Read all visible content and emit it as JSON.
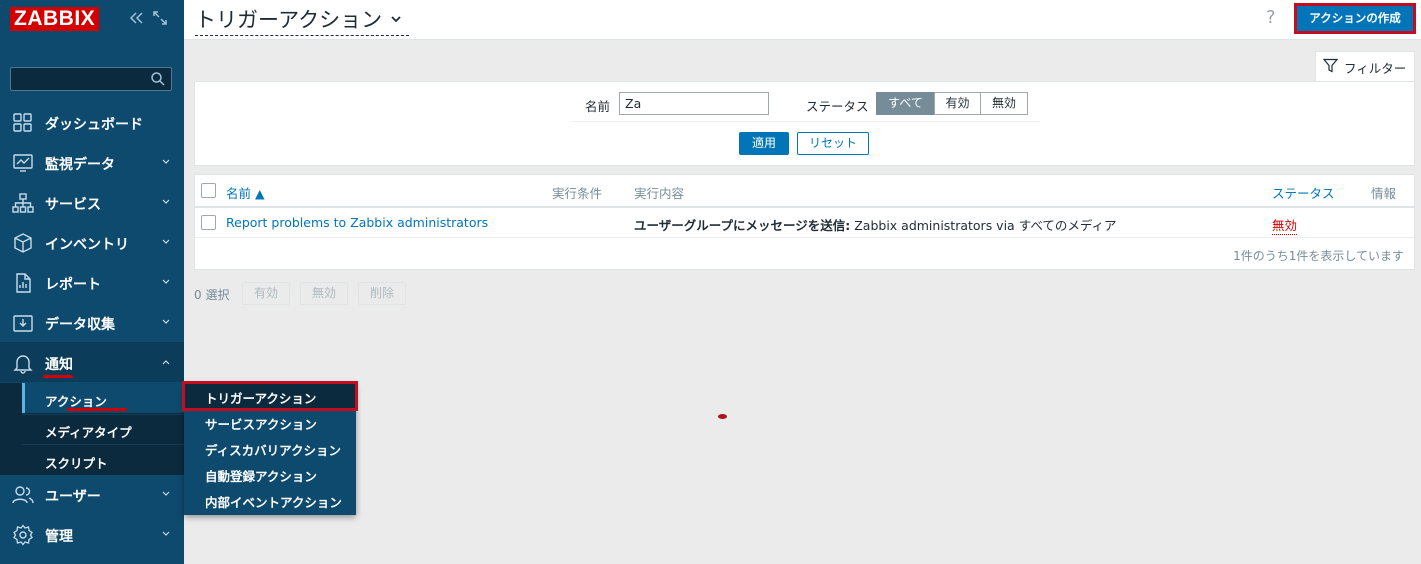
{
  "sidebar": {
    "logo": "ZABBIX",
    "search": {
      "placeholder": "",
      "value": ""
    },
    "items": [
      {
        "label": "ダッシュボード",
        "icon": "dashboard-icon"
      },
      {
        "label": "監視データ",
        "icon": "monitoring-icon"
      },
      {
        "label": "サービス",
        "icon": "services-icon"
      },
      {
        "label": "インベントリ",
        "icon": "inventory-icon"
      },
      {
        "label": "レポート",
        "icon": "reports-icon"
      },
      {
        "label": "データ収集",
        "icon": "data-collection-icon"
      },
      {
        "label": "通知",
        "icon": "bell-icon"
      },
      {
        "label": "ユーザー",
        "icon": "users-icon"
      },
      {
        "label": "管理",
        "icon": "gear-icon"
      }
    ],
    "submenu": [
      {
        "label": "アクション"
      },
      {
        "label": "メディアタイプ"
      },
      {
        "label": "スクリプト"
      }
    ],
    "flyout": [
      {
        "label": "トリガーアクション"
      },
      {
        "label": "サービスアクション"
      },
      {
        "label": "ディスカバリアクション"
      },
      {
        "label": "自動登録アクション"
      },
      {
        "label": "内部イベントアクション"
      }
    ]
  },
  "header": {
    "title": "トリガーアクション",
    "help": "?",
    "create_button": "アクションの作成"
  },
  "filter": {
    "tab_label": "フィルター",
    "name_label": "名前",
    "name_value": "Za",
    "status_label": "ステータス",
    "status_options": [
      "すべて",
      "有効",
      "無効"
    ],
    "status_selected": "すべて",
    "apply": "適用",
    "reset": "リセット"
  },
  "table": {
    "columns": {
      "name": "名前 ▲",
      "conditions": "実行条件",
      "operations": "実行内容",
      "status": "ステータス",
      "info": "情報"
    },
    "rows": [
      {
        "name": "Report problems to Zabbix administrators",
        "conditions": "",
        "operation_bold": "ユーザーグループにメッセージを送信:",
        "operation_rest": " Zabbix administrators via すべてのメディア",
        "status": "無効"
      }
    ],
    "footer": "1件のうち1件を表示しています"
  },
  "bulk": {
    "selected": "0 選択",
    "enable": "有効",
    "disable": "無効",
    "delete": "削除"
  },
  "colors": {
    "sidebar": "#0e4a6e",
    "accent": "#0275b8",
    "highlight": "#c40d1e",
    "status_disabled": "#d40000"
  }
}
